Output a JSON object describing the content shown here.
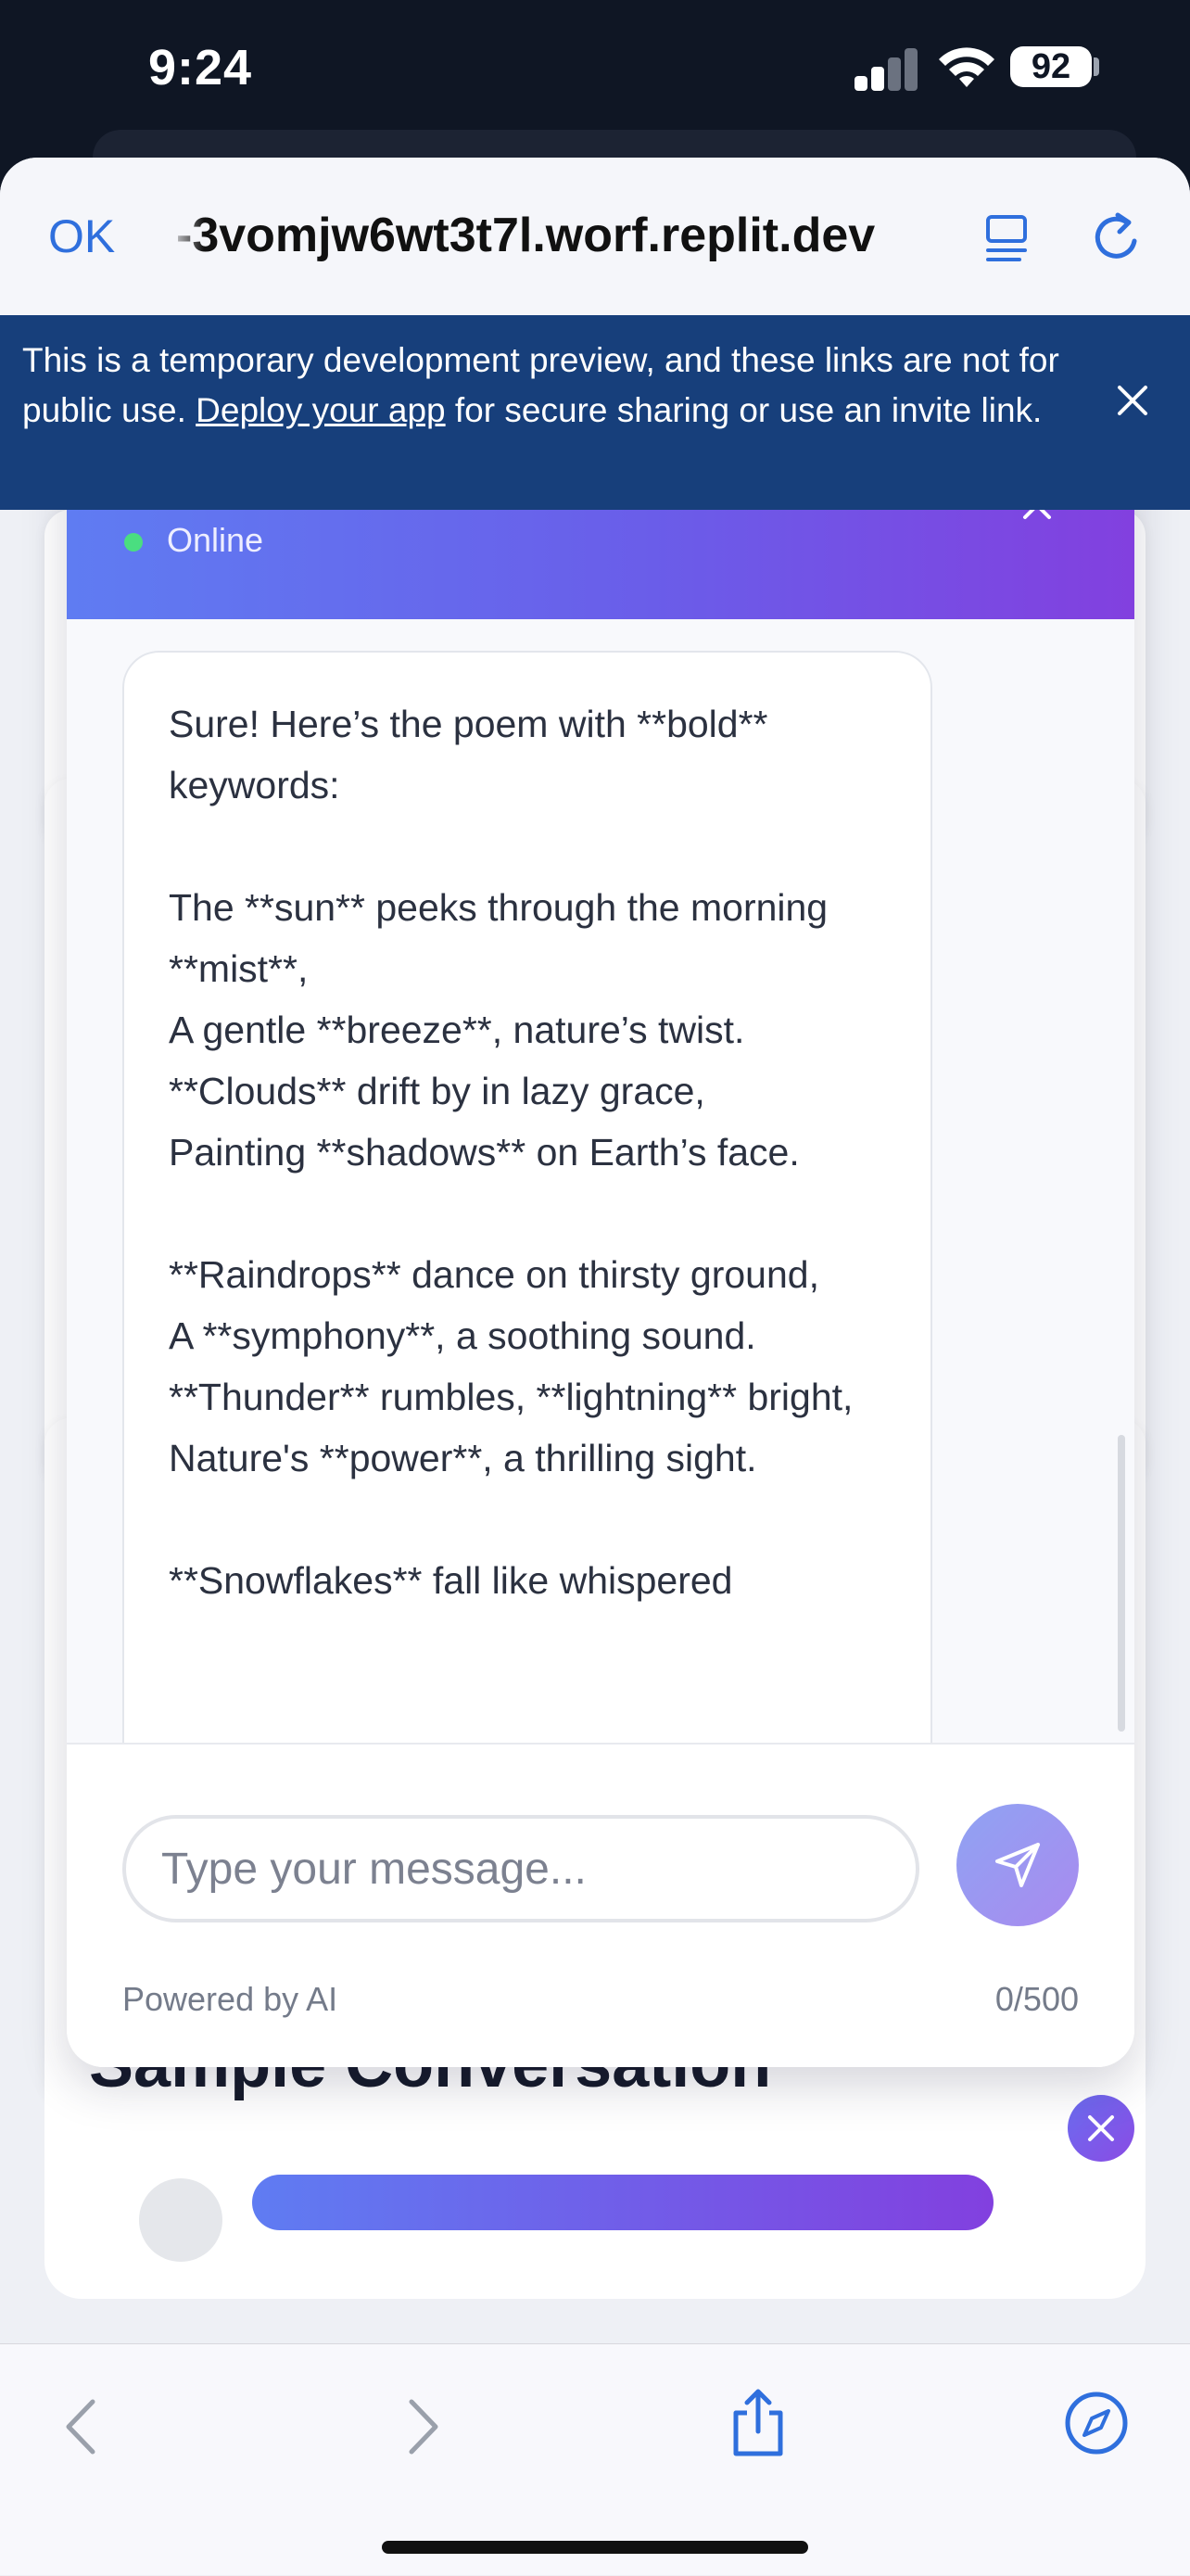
{
  "status_bar": {
    "time": "9:24",
    "battery": "92"
  },
  "browser": {
    "done_label": "OK",
    "url": "-3vomjw6wt3t7l.worf.replit.dev"
  },
  "banner": {
    "text_before": "This is a temporary development preview, and these links are not for public use. ",
    "link": "Deploy your app",
    "text_after": " for secure sharing or use an invite link."
  },
  "chat": {
    "status": "Online",
    "message": "Sure! Here’s the poem with **bold** keywords:\n\nThe **sun** peeks through the morning **mist**,\nA gentle **breeze**, nature’s twist.\n**Clouds** drift by in lazy grace,\nPainting **shadows** on Earth’s face.\n\n**Raindrops** dance on thirsty ground,\nA **symphony**, a soothing sound.\n**Thunder** rumbles, **lightning** bright,\nNature's **power**, a thrilling sight.\n\n**Snowflakes** fall like whispered",
    "input_placeholder": "Type your message...",
    "powered_by": "Powered by AI",
    "char_count": "0/500"
  },
  "sample": {
    "title": "Sample Conversation"
  },
  "colors": {
    "header_gradient_start": "#5f7cf2",
    "header_gradient_end": "#8240df",
    "banner_bg": "#173f7b",
    "online": "#4ade80",
    "ios_blue": "#2f6fdd"
  },
  "icons": [
    "reader-mode-icon",
    "reload-icon",
    "close-icon",
    "send-icon",
    "back-icon",
    "forward-icon",
    "share-icon",
    "compass-icon"
  ]
}
